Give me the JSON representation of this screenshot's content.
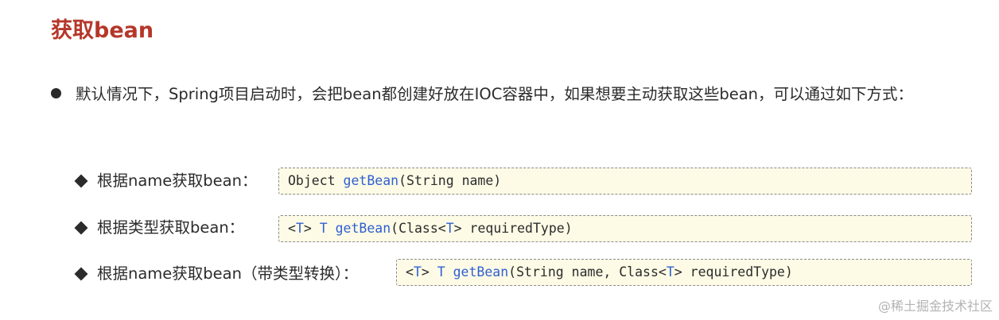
{
  "title": "获取bean",
  "intro": "默认情况下，Spring项目启动时，会把bean都创建好放在IOC容器中，如果想要主动获取这些bean，可以通过如下方式：",
  "methods": [
    {
      "label": "根据name获取bean：",
      "code": {
        "pre": "Object ",
        "method": "getBean",
        "args": "(String name)"
      }
    },
    {
      "label": "根据类型获取bean：",
      "code": {
        "lt": "<",
        "t1": "T",
        "gt_t": "> ",
        "t2": "T",
        "space": " ",
        "method": "getBean",
        "arg_a": "(Class<",
        "t3": "T",
        "arg_b": "> requiredType)"
      }
    },
    {
      "label": "根据name获取bean（带类型转换）：",
      "code": {
        "lt": "<",
        "t1": "T",
        "gt_t": "> ",
        "t2": "T",
        "space": " ",
        "method": "getBean",
        "arg_a": "(String name, Class<",
        "t3": "T",
        "arg_b": "> requiredType)"
      }
    }
  ],
  "watermark": "@稀土掘金技术社区",
  "colors": {
    "title": "#b5372a",
    "keyword": "#2f5fd0",
    "code_bg": "#fdfbe6"
  }
}
